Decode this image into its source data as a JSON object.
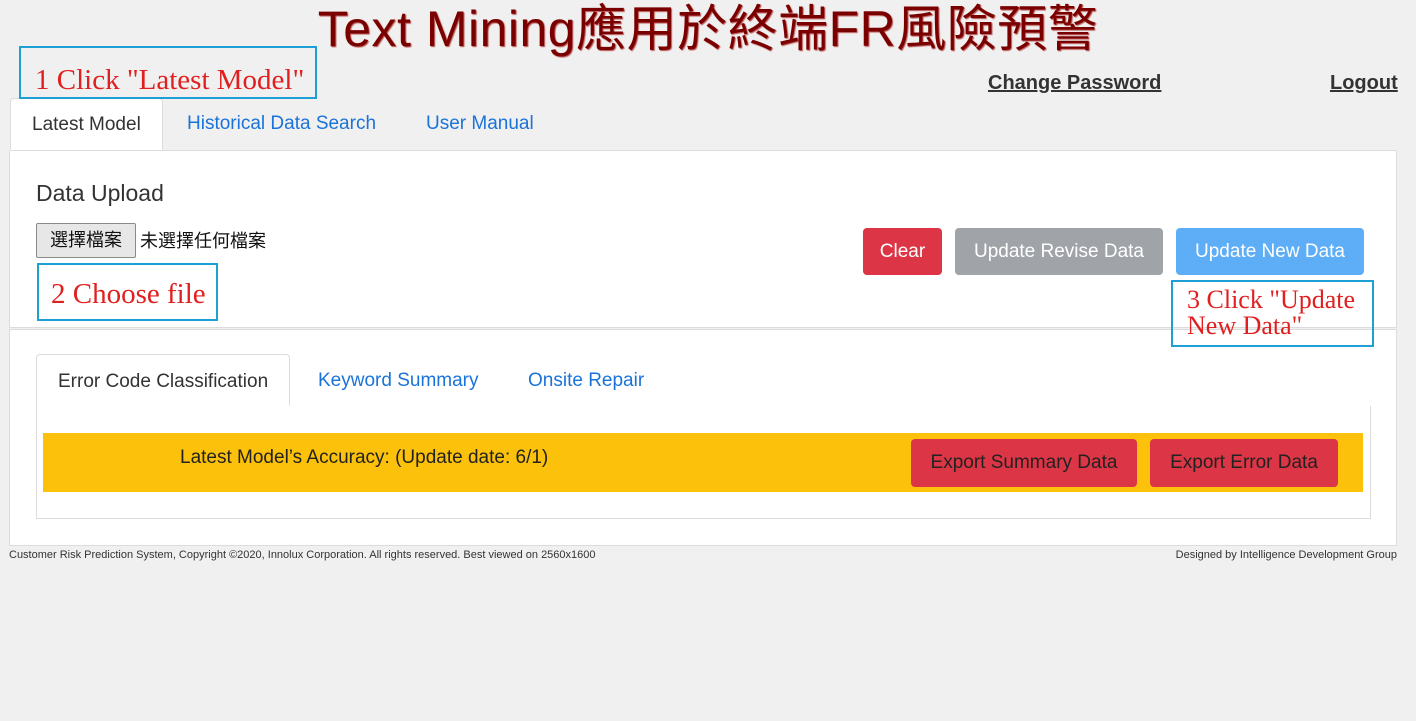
{
  "app": {
    "title": "Text Mining應用於終端FR風險預警"
  },
  "header": {
    "change_password": "Change Password",
    "logout": "Logout"
  },
  "tabs": [
    {
      "label": "Latest Model",
      "active": true
    },
    {
      "label": "Historical Data Search",
      "active": false
    },
    {
      "label": "User Manual",
      "active": false
    }
  ],
  "upload": {
    "title": "Data Upload",
    "choose_file_label": "選擇檔案",
    "file_status": "未選擇任何檔案",
    "clear_label": "Clear",
    "update_revise_label": "Update Revise Data",
    "update_new_label": "Update New Data"
  },
  "callouts": {
    "step1": "1 Click \"Latest Model\"",
    "step2": "2 Choose file",
    "step3": "3 Click \"Update New Data\""
  },
  "subtabs": [
    {
      "label": "Error Code Classification",
      "active": true
    },
    {
      "label": "Keyword Summary",
      "active": false
    },
    {
      "label": "Onsite Repair",
      "active": false
    }
  ],
  "accuracy_panel": {
    "text": "Latest Model’s Accuracy: (Update date: 6/1)",
    "export_summary_label": "Export Summary Data",
    "export_error_label": "Export Error Data"
  },
  "footer": {
    "left": "Customer Risk Prediction System, Copyright ©2020, Innolux Corporation. All rights reserved. Best viewed on 2560x1600",
    "right": "Designed by Intelligence Development Group"
  },
  "colors": {
    "title": "#7a0000",
    "link": "#1a73d9",
    "danger": "#dc3545",
    "secondary": "#a0a4a8",
    "primary_light": "#5daef7",
    "warning": "#fcc10a",
    "callout_border": "#1e9fd6",
    "callout_text": "#e02020"
  }
}
